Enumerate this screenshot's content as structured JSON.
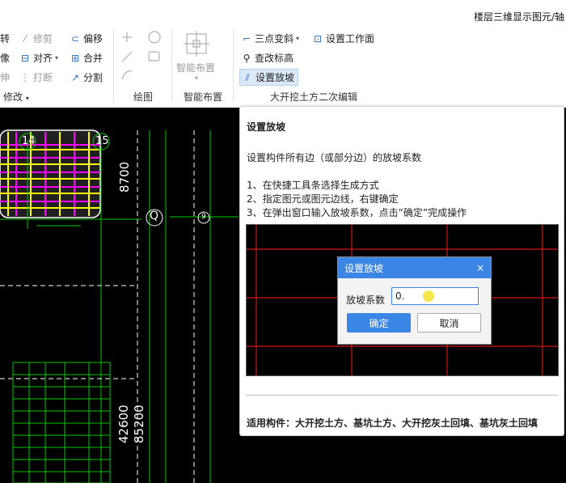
{
  "window": {
    "title": "楼层三维显示图元/轴"
  },
  "ribbon": {
    "modify": {
      "items": [
        {
          "label": "转"
        },
        {
          "label": "修剪"
        },
        {
          "label": "偏移"
        },
        {
          "label": "像"
        },
        {
          "label": "对齐"
        },
        {
          "label": "合并"
        },
        {
          "label": "伸"
        },
        {
          "label": "打断"
        },
        {
          "label": "分割"
        }
      ],
      "group_label": "修改"
    },
    "draw": {
      "group_label": "绘图"
    },
    "smart": {
      "button_label": "智能布置",
      "group_label": "智能布置"
    },
    "excavation": {
      "items": [
        {
          "label": "三点变斜"
        },
        {
          "label": "设置工作面"
        },
        {
          "label": "查改标高"
        },
        {
          "label": "设置放坡"
        }
      ],
      "group_label": "大开挖土方二次编辑"
    }
  },
  "cad": {
    "axis_labels": [
      "14",
      "15",
      "Q",
      "9"
    ],
    "dimensions": [
      "8700",
      "42600",
      "85200"
    ]
  },
  "help_panel": {
    "title": "设置放坡",
    "description": "设置构件所有边（或部分边）的放坡系数",
    "steps": [
      "1、在快捷工具条选择生成方式",
      "2、指定图元或图元边线，右键确定",
      "3、在弹出窗口输入放坡系数，点击“确定”完成操作"
    ],
    "footer": "适用构件：大开挖土方、基坑土方、大开挖灰土回填、基坑灰土回填"
  },
  "dialog": {
    "title": "设置放坡",
    "close": "×",
    "field_label": "放坡系数",
    "field_value": "0.",
    "ok": "确定",
    "cancel": "取消"
  },
  "colors": {
    "accent": "#3b86e4",
    "cad_bg": "#000000",
    "cad_grid": "#00c800",
    "cad_magenta": "#ff00ff",
    "cad_yellow": "#ffff00",
    "slope_red": "#d01818"
  }
}
